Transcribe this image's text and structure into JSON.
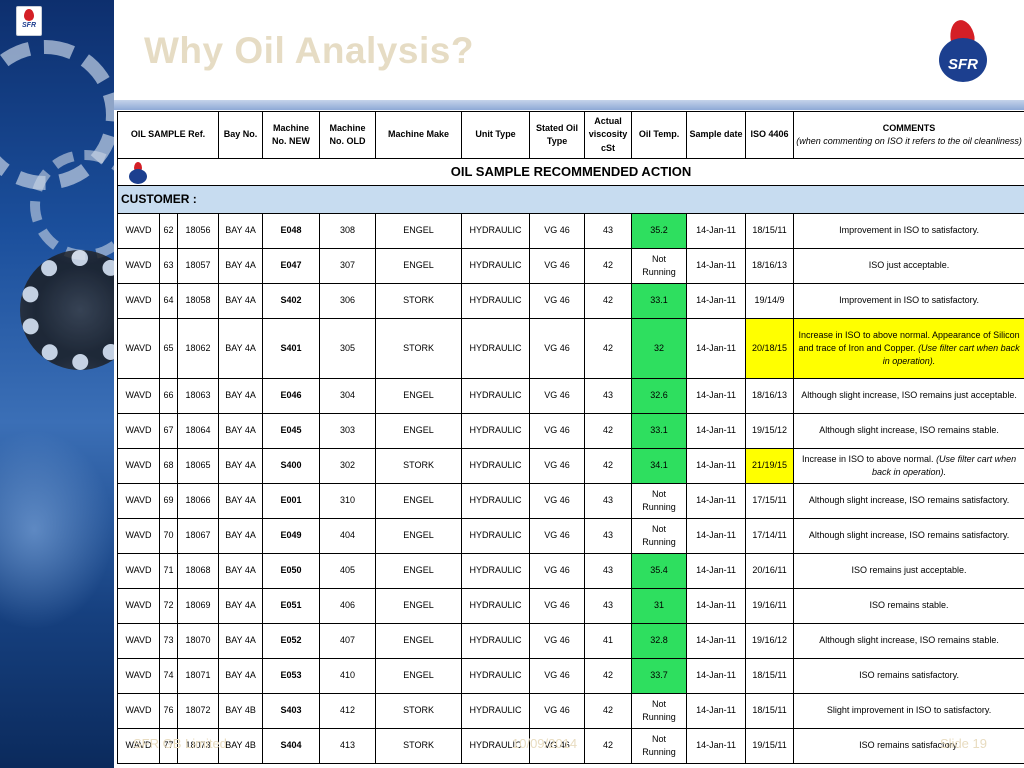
{
  "slide": {
    "title": "Why Oil Analysis?",
    "corner_logo_text": "SFR",
    "brand_logo_text": "SFR",
    "footer_left": "SFR GB Limited",
    "footer_date": "10/09/2014",
    "footer_slide": "Slide 19"
  },
  "table": {
    "title": "OIL SAMPLE RECOMMENDED ACTION",
    "customer_label": "CUSTOMER :",
    "headers": {
      "ref": "OIL SAMPLE Ref.",
      "bay": "Bay No.",
      "machine_new": "Machine No. NEW",
      "machine_old": "Machine No. OLD",
      "make": "Machine Make",
      "unit": "Unit Type",
      "stated_oil": "Stated Oil Type",
      "viscosity": "Actual viscosity cSt",
      "oil_temp": "Oil Temp.",
      "sample_date": "Sample date",
      "iso": "ISO 4406",
      "comments": "COMMENTS",
      "comments_note": "(when commenting on ISO it refers to the oil cleanliness)"
    },
    "colors": {
      "green": "#2edf5f",
      "yellow": "#ffff00",
      "customer_bg": "#c7dcf0"
    },
    "rows": [
      {
        "r1": "WAVD",
        "r2": "62",
        "r3": "18056",
        "bay": "BAY 4A",
        "mnew": "E048",
        "mold": "308",
        "make": "ENGEL",
        "unit": "HYDRAULIC",
        "oil": "VG 46",
        "visc": "43",
        "temp": "35.2",
        "temp_green": true,
        "date": "14-Jan-11",
        "iso": "18/15/11",
        "iso_yellow": false,
        "comment": "Improvement in ISO to satisfactory.",
        "comment_note": "",
        "comment_yellow": false,
        "tall": false
      },
      {
        "r1": "WAVD",
        "r2": "63",
        "r3": "18057",
        "bay": "BAY 4A",
        "mnew": "E047",
        "mold": "307",
        "make": "ENGEL",
        "unit": "HYDRAULIC",
        "oil": "VG 46",
        "visc": "42",
        "temp": "Not Running",
        "temp_green": false,
        "date": "14-Jan-11",
        "iso": "18/16/13",
        "iso_yellow": false,
        "comment": "ISO just acceptable.",
        "comment_note": "",
        "comment_yellow": false,
        "tall": false
      },
      {
        "r1": "WAVD",
        "r2": "64",
        "r3": "18058",
        "bay": "BAY 4A",
        "mnew": "S402",
        "mold": "306",
        "make": "STORK",
        "unit": "HYDRAULIC",
        "oil": "VG 46",
        "visc": "42",
        "temp": "33.1",
        "temp_green": true,
        "date": "14-Jan-11",
        "iso": "19/14/9",
        "iso_yellow": false,
        "comment": "Improvement in ISO to satisfactory.",
        "comment_note": "",
        "comment_yellow": false,
        "tall": false
      },
      {
        "r1": "WAVD",
        "r2": "65",
        "r3": "18062",
        "bay": "BAY 4A",
        "mnew": "S401",
        "mold": "305",
        "make": "STORK",
        "unit": "HYDRAULIC",
        "oil": "VG 46",
        "visc": "42",
        "temp": "32",
        "temp_green": true,
        "date": "14-Jan-11",
        "iso": "20/18/15",
        "iso_yellow": true,
        "comment": "Increase in ISO to above normal. Appearance of Silicon and trace of Iron and Copper.",
        "comment_note": "(Use filter cart when back in operation).",
        "comment_yellow": true,
        "tall": true
      },
      {
        "r1": "WAVD",
        "r2": "66",
        "r3": "18063",
        "bay": "BAY 4A",
        "mnew": "E046",
        "mold": "304",
        "make": "ENGEL",
        "unit": "HYDRAULIC",
        "oil": "VG 46",
        "visc": "43",
        "temp": "32.6",
        "temp_green": true,
        "date": "14-Jan-11",
        "iso": "18/16/13",
        "iso_yellow": false,
        "comment": "Although slight increase, ISO remains just acceptable.",
        "comment_note": "",
        "comment_yellow": false,
        "tall": false
      },
      {
        "r1": "WAVD",
        "r2": "67",
        "r3": "18064",
        "bay": "BAY 4A",
        "mnew": "E045",
        "mold": "303",
        "make": "ENGEL",
        "unit": "HYDRAULIC",
        "oil": "VG 46",
        "visc": "42",
        "temp": "33.1",
        "temp_green": true,
        "date": "14-Jan-11",
        "iso": "19/15/12",
        "iso_yellow": false,
        "comment": "Although slight increase, ISO remains stable.",
        "comment_note": "",
        "comment_yellow": false,
        "tall": false
      },
      {
        "r1": "WAVD",
        "r2": "68",
        "r3": "18065",
        "bay": "BAY 4A",
        "mnew": "S400",
        "mold": "302",
        "make": "STORK",
        "unit": "HYDRAULIC",
        "oil": "VG 46",
        "visc": "42",
        "temp": "34.1",
        "temp_green": true,
        "date": "14-Jan-11",
        "iso": "21/19/15",
        "iso_yellow": true,
        "comment": "Increase in ISO to above normal.",
        "comment_note": "(Use filter cart when back in operation).",
        "comment_yellow": false,
        "tall": false
      },
      {
        "r1": "WAVD",
        "r2": "69",
        "r3": "18066",
        "bay": "BAY 4A",
        "mnew": "E001",
        "mold": "310",
        "make": "ENGEL",
        "unit": "HYDRAULIC",
        "oil": "VG 46",
        "visc": "43",
        "temp": "Not Running",
        "temp_green": false,
        "date": "14-Jan-11",
        "iso": "17/15/11",
        "iso_yellow": false,
        "comment": "Although slight increase, ISO remains satisfactory.",
        "comment_note": "",
        "comment_yellow": false,
        "tall": false
      },
      {
        "r1": "WAVD",
        "r2": "70",
        "r3": "18067",
        "bay": "BAY 4A",
        "mnew": "E049",
        "mold": "404",
        "make": "ENGEL",
        "unit": "HYDRAULIC",
        "oil": "VG 46",
        "visc": "43",
        "temp": "Not Running",
        "temp_green": false,
        "date": "14-Jan-11",
        "iso": "17/14/11",
        "iso_yellow": false,
        "comment": "Although slight increase, ISO remains satisfactory.",
        "comment_note": "",
        "comment_yellow": false,
        "tall": false
      },
      {
        "r1": "WAVD",
        "r2": "71",
        "r3": "18068",
        "bay": "BAY 4A",
        "mnew": "E050",
        "mold": "405",
        "make": "ENGEL",
        "unit": "HYDRAULIC",
        "oil": "VG 46",
        "visc": "43",
        "temp": "35.4",
        "temp_green": true,
        "date": "14-Jan-11",
        "iso": "20/16/11",
        "iso_yellow": false,
        "comment": "ISO remains just acceptable.",
        "comment_note": "",
        "comment_yellow": false,
        "tall": false
      },
      {
        "r1": "WAVD",
        "r2": "72",
        "r3": "18069",
        "bay": "BAY 4A",
        "mnew": "E051",
        "mold": "406",
        "make": "ENGEL",
        "unit": "HYDRAULIC",
        "oil": "VG 46",
        "visc": "43",
        "temp": "31",
        "temp_green": true,
        "date": "14-Jan-11",
        "iso": "19/16/11",
        "iso_yellow": false,
        "comment": "ISO remains stable.",
        "comment_note": "",
        "comment_yellow": false,
        "tall": false
      },
      {
        "r1": "WAVD",
        "r2": "73",
        "r3": "18070",
        "bay": "BAY 4A",
        "mnew": "E052",
        "mold": "407",
        "make": "ENGEL",
        "unit": "HYDRAULIC",
        "oil": "VG 46",
        "visc": "41",
        "temp": "32.8",
        "temp_green": true,
        "date": "14-Jan-11",
        "iso": "19/16/12",
        "iso_yellow": false,
        "comment": "Although slight increase, ISO remains stable.",
        "comment_note": "",
        "comment_yellow": false,
        "tall": false
      },
      {
        "r1": "WAVD",
        "r2": "74",
        "r3": "18071",
        "bay": "BAY 4A",
        "mnew": "E053",
        "mold": "410",
        "make": "ENGEL",
        "unit": "HYDRAULIC",
        "oil": "VG 46",
        "visc": "42",
        "temp": "33.7",
        "temp_green": true,
        "date": "14-Jan-11",
        "iso": "18/15/11",
        "iso_yellow": false,
        "comment": "ISO remains satisfactory.",
        "comment_note": "",
        "comment_yellow": false,
        "tall": false
      },
      {
        "r1": "WAVD",
        "r2": "76",
        "r3": "18072",
        "bay": "BAY 4B",
        "mnew": "S403",
        "mold": "412",
        "make": "STORK",
        "unit": "HYDRAULIC",
        "oil": "VG 46",
        "visc": "42",
        "temp": "Not Running",
        "temp_green": false,
        "date": "14-Jan-11",
        "iso": "18/15/11",
        "iso_yellow": false,
        "comment": "Slight improvement in ISO to satisfactory.",
        "comment_note": "",
        "comment_yellow": false,
        "tall": false
      },
      {
        "r1": "WAVD",
        "r2": "77",
        "r3": "18073",
        "bay": "BAY 4B",
        "mnew": "S404",
        "mold": "413",
        "make": "STORK",
        "unit": "HYDRAULIC",
        "oil": "VG 46",
        "visc": "42",
        "temp": "Not Running",
        "temp_green": false,
        "date": "14-Jan-11",
        "iso": "19/15/11",
        "iso_yellow": false,
        "comment": "ISO  remains satisfactory.",
        "comment_note": "",
        "comment_yellow": false,
        "tall": false
      }
    ]
  }
}
